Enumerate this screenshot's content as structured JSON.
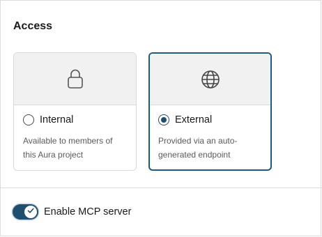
{
  "access": {
    "title": "Access",
    "options": [
      {
        "label": "Internal",
        "description": "Available to members of this Aura project",
        "icon": "lock-icon",
        "selected": false
      },
      {
        "label": "External",
        "description": "Provided via an auto-generated endpoint",
        "icon": "globe-icon",
        "selected": true
      }
    ]
  },
  "mcp": {
    "toggle_label": "Enable MCP server",
    "enabled": true
  },
  "colors": {
    "accent": "#1e4f6e",
    "selected_border": "#1e5a7a"
  }
}
